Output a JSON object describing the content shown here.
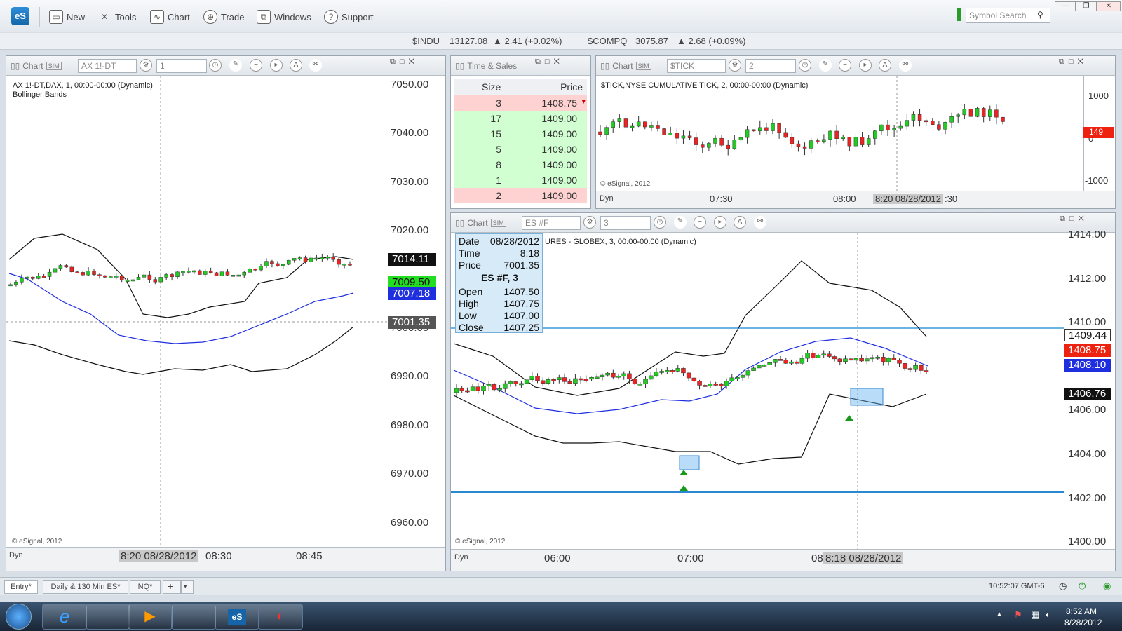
{
  "toolbar": {
    "logo": "eS",
    "new": "New",
    "tools": "Tools",
    "chart": "Chart",
    "trade": "Trade",
    "windows": "Windows",
    "support": "Support",
    "search_placeholder": "Symbol Search"
  },
  "ticker": {
    "indu_sym": "$INDU",
    "indu_val": "13127.08",
    "indu_chg": "▲ 2.41 (+0.02%)",
    "comp_sym": "$COMPQ",
    "comp_val": "3075.87",
    "comp_chg": "▲ 2.68 (+0.09%)"
  },
  "chart1": {
    "title": "Chart",
    "symbol": "AX 1!-DT",
    "interval": "1",
    "desc": "AX 1!-DT,DAX, 1, 00:00-00:00 (Dynamic)",
    "study": "Bollinger Bands",
    "ticks": [
      "7050.00",
      "7040.00",
      "7030.00",
      "7020.00",
      "7010.00",
      "7000.00",
      "6990.00",
      "6980.00",
      "6970.00",
      "6960.00"
    ],
    "tags": {
      "upper": "7014.11",
      "last": "7009.50",
      "mid": "7007.18",
      "cursor": "7001.35"
    },
    "copyright": "© eSignal, 2012",
    "time_labels": [
      "8:20 08/28/2012",
      "08:30",
      "08:45"
    ],
    "dyn": "Dyn"
  },
  "ts": {
    "title": "Time & Sales",
    "col_size": "Size",
    "col_price": "Price",
    "rows": [
      {
        "size": "3",
        "price": "1408.75",
        "color": "#ffd2d2"
      },
      {
        "size": "17",
        "price": "1409.00",
        "color": "#d2ffd2"
      },
      {
        "size": "15",
        "price": "1409.00",
        "color": "#d2ffd2"
      },
      {
        "size": "5",
        "price": "1409.00",
        "color": "#d2ffd2"
      },
      {
        "size": "8",
        "price": "1409.00",
        "color": "#d2ffd2"
      },
      {
        "size": "1",
        "price": "1409.00",
        "color": "#d2ffd2"
      },
      {
        "size": "2",
        "price": "1409.00",
        "color": "#ffd2d2"
      }
    ]
  },
  "chart2": {
    "title": "Chart",
    "symbol": "$TICK",
    "interval": "2",
    "desc": "$TICK,NYSE CUMULATIVE TICK, 2, 00:00-00:00 (Dynamic)",
    "ticks": [
      "1000",
      "0",
      "-1000"
    ],
    "tag": "149",
    "copyright": "© eSignal, 2012",
    "time_labels": [
      "07:30",
      "08:00",
      "8:20 08/28/2012",
      ":30"
    ],
    "dyn": "Dyn"
  },
  "chart3": {
    "title": "Chart",
    "symbol": "ES #F",
    "interval": "3",
    "desc": "URES - GLOBEX, 3, 00:00-00:00 (Dynamic)",
    "ticks": [
      "1414.00",
      "1412.00",
      "1410.00",
      "1408.00",
      "1406.00",
      "1404.00",
      "1402.00",
      "1400.00"
    ],
    "tags": {
      "hline": "1409.44",
      "last": "1408.75",
      "mid": "1408.10",
      "lower": "1406.76"
    },
    "copyright": "© eSignal, 2012",
    "time_labels": [
      "06:00",
      "07:00",
      "08",
      "8:18 08/28/2012"
    ],
    "dyn": "Dyn",
    "info": {
      "date_l": "Date",
      "date": "08/28/2012",
      "time_l": "Time",
      "time": "8:18",
      "price_l": "Price",
      "price": "7001.35",
      "sym": "ES #F, 3",
      "open_l": "Open",
      "open": "1407.50",
      "high_l": "High",
      "high": "1407.75",
      "low_l": "Low",
      "low": "1407.00",
      "close_l": "Close",
      "close": "1407.25"
    }
  },
  "tabs": [
    "Entry*",
    "Daily & 130 Min ES*",
    "NQ*"
  ],
  "status": {
    "clock": "10:52:07 GMT-6"
  },
  "taskbar": {
    "time": "8:52 AM",
    "date": "8/28/2012"
  }
}
